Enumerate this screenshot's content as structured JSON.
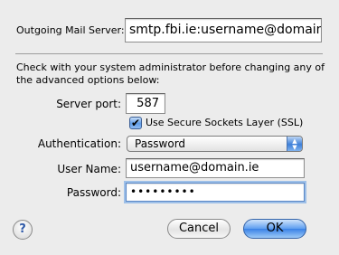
{
  "outgoing": {
    "label": "Outgoing Mail Server:",
    "value": "smtp.fbi.ie:username@domain.ie"
  },
  "note": {
    "line1": "Check with your system administrator before changing any of",
    "line2": "the advanced options below:"
  },
  "port": {
    "label": "Server port:",
    "value": "587"
  },
  "ssl": {
    "label": "Use Secure Sockets Layer (SSL)",
    "checked": true,
    "check_glyph": "✔"
  },
  "authentication": {
    "label": "Authentication:",
    "selected": "Password"
  },
  "username": {
    "label": "User Name:",
    "value": "username@domain.ie"
  },
  "password": {
    "label": "Password:",
    "value": "•••••••••"
  },
  "buttons": {
    "help": "?",
    "cancel": "Cancel",
    "ok": "OK"
  },
  "icons": {
    "help": "help-icon",
    "checkbox": "checkmark-icon",
    "popup": "up-down-arrows-icon"
  },
  "colors": {
    "accent": "#3a82e6",
    "window_bg": "#ececec"
  }
}
